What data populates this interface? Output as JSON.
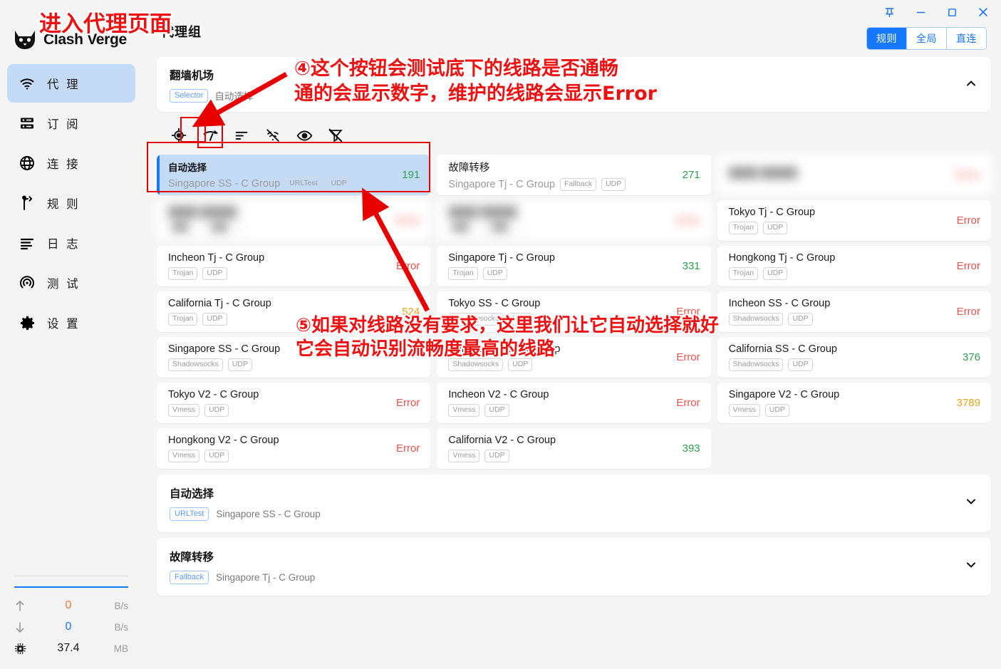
{
  "app": {
    "brand": "Clash Verge",
    "page_title": "代理组"
  },
  "window_controls": [
    {
      "name": "pin",
      "glyph": "pin-icon"
    },
    {
      "name": "minimize",
      "glyph": "minimize-icon"
    },
    {
      "name": "maximize",
      "glyph": "maximize-icon"
    },
    {
      "name": "close",
      "glyph": "close-icon"
    }
  ],
  "modes": {
    "options": [
      "规则",
      "全局",
      "直连"
    ],
    "selected": "规则",
    "accent": "#1677ff"
  },
  "sidebar": {
    "items": [
      {
        "label": "代 理",
        "icon": "wifi-icon",
        "active": true
      },
      {
        "label": "订 阅",
        "icon": "server-icon",
        "active": false
      },
      {
        "label": "连 接",
        "icon": "globe-icon",
        "active": false
      },
      {
        "label": "规 则",
        "icon": "branch-icon",
        "active": false
      },
      {
        "label": "日 志",
        "icon": "list-icon",
        "active": false
      },
      {
        "label": "测 试",
        "icon": "radar-icon",
        "active": false
      },
      {
        "label": "设 置",
        "icon": "gear-icon",
        "active": false
      }
    ],
    "stats": [
      {
        "icon": "arrow-up-icon",
        "value": "0",
        "unit": "B/s",
        "color": "#f2713a"
      },
      {
        "icon": "arrow-down-icon",
        "value": "0",
        "unit": "B/s",
        "color": "#1976f5"
      },
      {
        "icon": "chip-icon",
        "value": "37.4",
        "unit": "MB",
        "color": "#1a1a1a"
      }
    ]
  },
  "group": {
    "name": "翻墙机场",
    "type_chip": "Selector",
    "current": "自动选择",
    "collapse_icon": "chevron-up-icon"
  },
  "toolbar": [
    {
      "name": "locate-current-icon",
      "highlighted": false
    },
    {
      "name": "speed-test-icon",
      "highlighted": true
    },
    {
      "name": "sort-icon",
      "highlighted": false
    },
    {
      "name": "hide-unavailable-icon",
      "highlighted": false
    },
    {
      "name": "show-detail-icon",
      "highlighted": false
    },
    {
      "name": "filter-icon",
      "highlighted": false
    }
  ],
  "proxies": [
    {
      "title": "自动选择",
      "now": "Singapore SS - C Group",
      "tags": [
        "URLTest",
        "UDP"
      ],
      "delay": "191",
      "delay_state": "green",
      "selected": true,
      "blurred": false
    },
    {
      "title": "故障转移",
      "now": "Singapore Tj - C Group",
      "tags": [
        "Fallback",
        "UDP"
      ],
      "delay": "271",
      "delay_state": "green",
      "selected": false,
      "blurred": false
    },
    {
      "title": "",
      "now": "",
      "tags": [],
      "delay": "",
      "delay_state": "error",
      "selected": false,
      "blurred": true
    },
    {
      "title": "",
      "now": "",
      "tags": [
        "",
        ""
      ],
      "delay": "",
      "delay_state": "error",
      "selected": false,
      "blurred": true
    },
    {
      "title": "",
      "now": "",
      "tags": [
        "",
        ""
      ],
      "delay": "",
      "delay_state": "error",
      "selected": false,
      "blurred": true
    },
    {
      "title": "Tokyo Tj - C Group",
      "now": "",
      "tags": [
        "Trojan",
        "UDP"
      ],
      "delay": "Error",
      "delay_state": "error",
      "selected": false,
      "blurred": false
    },
    {
      "title": "Incheon Tj - C Group",
      "now": "",
      "tags": [
        "Trojan",
        "UDP"
      ],
      "delay": "Error",
      "delay_state": "error",
      "selected": false,
      "blurred": false
    },
    {
      "title": "Singapore Tj - C Group",
      "now": "",
      "tags": [
        "Trojan",
        "UDP"
      ],
      "delay": "331",
      "delay_state": "green",
      "selected": false,
      "blurred": false
    },
    {
      "title": "Hongkong Tj - C Group",
      "now": "",
      "tags": [
        "Trojan",
        "UDP"
      ],
      "delay": "Error",
      "delay_state": "error",
      "selected": false,
      "blurred": false
    },
    {
      "title": "California Tj - C Group",
      "now": "",
      "tags": [
        "Trojan",
        "UDP"
      ],
      "delay": "524",
      "delay_state": "orange",
      "selected": false,
      "blurred": false
    },
    {
      "title": "Tokyo SS - C Group",
      "now": "",
      "tags": [
        "Shadowsocks",
        "UDP"
      ],
      "delay": "Error",
      "delay_state": "error",
      "selected": false,
      "blurred": false
    },
    {
      "title": "Incheon SS - C Group",
      "now": "",
      "tags": [
        "Shadowsocks",
        "UDP"
      ],
      "delay": "Error",
      "delay_state": "error",
      "selected": false,
      "blurred": false
    },
    {
      "title": "Singapore SS - C Group",
      "now": "",
      "tags": [
        "Shadowsocks",
        "UDP"
      ],
      "delay": "",
      "delay_state": "green",
      "selected": false,
      "blurred": false
    },
    {
      "title": "Hongkong SS - C Group",
      "now": "",
      "tags": [
        "Shadowsocks",
        "UDP"
      ],
      "delay": "Error",
      "delay_state": "error",
      "selected": false,
      "blurred": false
    },
    {
      "title": "California SS - C Group",
      "now": "",
      "tags": [
        "Shadowsocks",
        "UDP"
      ],
      "delay": "376",
      "delay_state": "green",
      "selected": false,
      "blurred": false
    },
    {
      "title": "Tokyo V2 - C Group",
      "now": "",
      "tags": [
        "Vmess",
        "UDP"
      ],
      "delay": "Error",
      "delay_state": "error",
      "selected": false,
      "blurred": false
    },
    {
      "title": "Incheon V2 - C Group",
      "now": "",
      "tags": [
        "Vmess",
        "UDP"
      ],
      "delay": "Error",
      "delay_state": "error",
      "selected": false,
      "blurred": false
    },
    {
      "title": "Singapore V2 - C Group",
      "now": "",
      "tags": [
        "Vmess",
        "UDP"
      ],
      "delay": "3789",
      "delay_state": "orange",
      "selected": false,
      "blurred": false
    },
    {
      "title": "Hongkong V2 - C Group",
      "now": "",
      "tags": [
        "Vmess",
        "UDP"
      ],
      "delay": "Error",
      "delay_state": "error",
      "selected": false,
      "blurred": false
    },
    {
      "title": "California V2 - C Group",
      "now": "",
      "tags": [
        "Vmess",
        "UDP"
      ],
      "delay": "393",
      "delay_state": "green",
      "selected": false,
      "blurred": false
    }
  ],
  "collapsed_groups": [
    {
      "name": "自动选择",
      "chip": "URLTest",
      "now": "Singapore SS - C Group",
      "collapse_icon": "chevron-down-icon"
    },
    {
      "name": "故障转移",
      "chip": "Fallback",
      "now": "Singapore Tj - C Group",
      "collapse_icon": "chevron-down-icon"
    }
  ],
  "annotations": {
    "title": "进入代理页面",
    "note4_line1": "④这个按钮会测试底下的线路是否通畅",
    "note4_line2": "通的会显示数字，维护的线路会显示Error",
    "note5_line1": "⑤如果对线路没有要求，这里我们让它自动选择就好",
    "note5_line2": "它会自动识别流畅度最高的线路",
    "color": "#ee1111"
  }
}
